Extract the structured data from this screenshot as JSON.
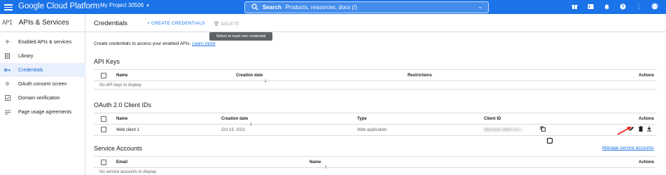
{
  "topbar": {
    "brand": "Google Cloud Platform",
    "project": "My Project 30506",
    "search_label": "Search",
    "search_placeholder": "Products, resources, docs (/)",
    "icons": [
      "gift-icon",
      "terminal-icon",
      "notifications-icon",
      "help-icon",
      "more-vert-icon",
      "avatar"
    ]
  },
  "leftnav": {
    "api_icon": "API",
    "title": "APIs & Services",
    "items": [
      {
        "label": "Enabled APIs & services",
        "icon": "apis-icon",
        "active": false
      },
      {
        "label": "Library",
        "icon": "library-icon",
        "active": false
      },
      {
        "label": "Credentials",
        "icon": "key-icon",
        "active": true
      },
      {
        "label": "OAuth consent screen",
        "icon": "consent-icon",
        "active": false
      },
      {
        "label": "Domain verification",
        "icon": "domain-checkbox-icon",
        "active": false
      },
      {
        "label": "Page usage agreements",
        "icon": "agreements-icon",
        "active": false
      }
    ]
  },
  "header": {
    "title": "Credentials",
    "create_label": "CREATE CREDENTIALS",
    "delete_label": "DELETE",
    "tooltip": "Select at least one credential"
  },
  "intro": {
    "text": "Create credentials to access your enabled APIs.",
    "link": "Learn more"
  },
  "api_keys": {
    "title": "API Keys",
    "columns": [
      "Name",
      "Creation date",
      "Restrictions",
      "Actions"
    ],
    "empty": "No API keys to display"
  },
  "oauth": {
    "title": "OAuth 2.0 Client IDs",
    "columns": [
      "Name",
      "Creation date",
      "Type",
      "Client ID",
      "Actions"
    ],
    "rows": [
      {
        "name": "Web client 1",
        "date": "Oct 19, 2021",
        "type": "Web application",
        "client_id": "665532674685-ot7t..."
      }
    ]
  },
  "service_accounts": {
    "title": "Service Accounts",
    "manage_link": "Manage service accounts",
    "columns": [
      "Email",
      "Name",
      "Actions"
    ],
    "empty": "No service accounts to display"
  },
  "colors": {
    "brand_blue": "#1a73e8",
    "active_bg": "#e8f0fe",
    "arrow_red": "#e8170f"
  }
}
